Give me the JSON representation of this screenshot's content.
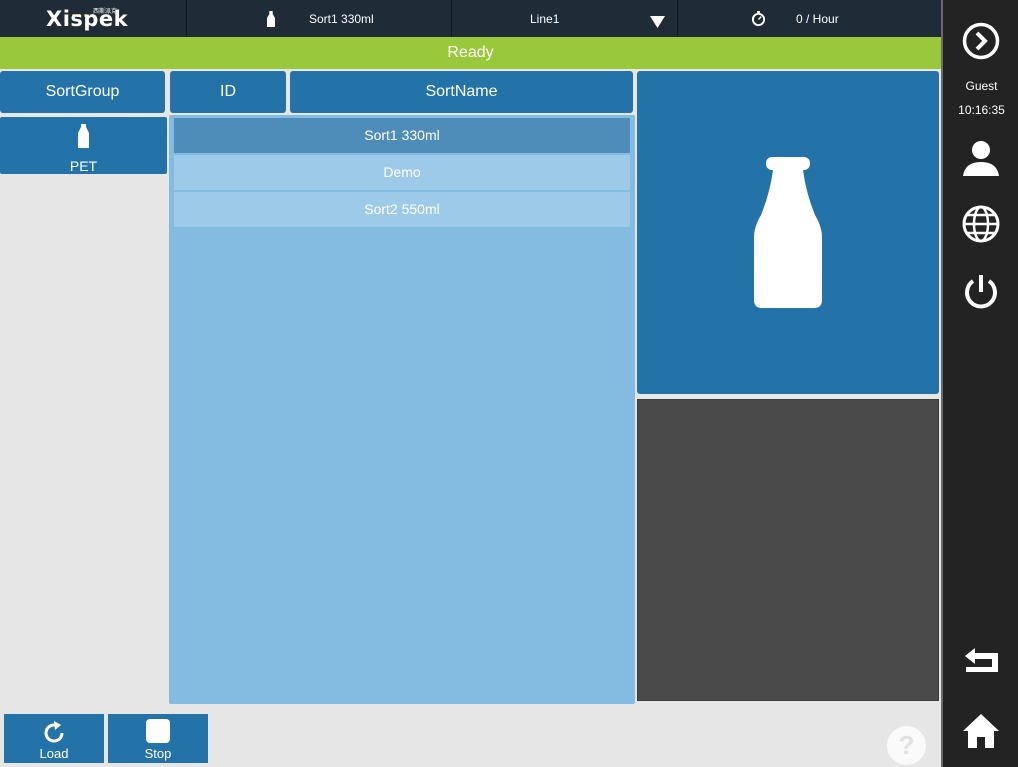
{
  "brand": {
    "name": "Xispek",
    "subtitle": "西斯派克"
  },
  "topbar": {
    "current_sort": "Sort1 330ml",
    "line": "Line1",
    "rate": "0 / Hour"
  },
  "status": {
    "text": "Ready",
    "color": "#99c93a"
  },
  "headers": {
    "sort_group": "SortGroup",
    "id": "ID",
    "sort_name": "SortName"
  },
  "groups": [
    {
      "label": "PET",
      "icon": "bottle-icon"
    }
  ],
  "sorts": [
    {
      "id": "",
      "name": "Sort1 330ml",
      "selected": true
    },
    {
      "id": "",
      "name": "Demo",
      "selected": false
    },
    {
      "id": "",
      "name": "Sort2 550ml",
      "selected": false
    }
  ],
  "buttons": {
    "load": "Load",
    "stop": "Stop"
  },
  "help": {
    "label": "?"
  },
  "sidebar": {
    "user": "Guest",
    "time": "10:16:35",
    "icons": [
      "chevron-right-circle-icon",
      "user-icon",
      "globe-icon",
      "power-icon",
      "return-icon",
      "home-icon"
    ]
  },
  "colors": {
    "accent": "#2473a8",
    "topbar": "#1f2b36",
    "list_bg": "#84bce1",
    "sidebar": "#232323"
  }
}
